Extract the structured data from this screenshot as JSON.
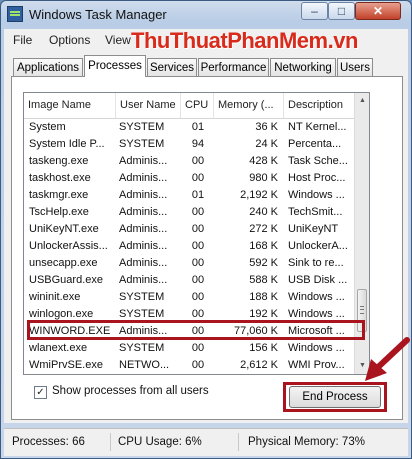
{
  "window": {
    "title": "Windows Task Manager",
    "min_glyph": "–",
    "max_glyph": "□",
    "close_glyph": "✕"
  },
  "menu": [
    "File",
    "Options",
    "View"
  ],
  "watermark": "ThuThuatPhanMem.vn",
  "tabs": [
    {
      "label": "Applications",
      "active": false
    },
    {
      "label": "Processes",
      "active": true
    },
    {
      "label": "Services",
      "active": false
    },
    {
      "label": "Performance",
      "active": false
    },
    {
      "label": "Networking",
      "active": false
    },
    {
      "label": "Users",
      "active": false
    }
  ],
  "columns": [
    "Image Name",
    "User Name",
    "CPU",
    "Memory (...",
    "Description"
  ],
  "rows": [
    [
      "System",
      "SYSTEM",
      "01",
      "36 K",
      "NT Kernel..."
    ],
    [
      "System Idle P...",
      "SYSTEM",
      "94",
      "24 K",
      "Percenta..."
    ],
    [
      "taskeng.exe",
      "Adminis...",
      "00",
      "428 K",
      "Task Sche..."
    ],
    [
      "taskhost.exe",
      "Adminis...",
      "00",
      "980 K",
      "Host Proc..."
    ],
    [
      "taskmgr.exe",
      "Adminis...",
      "01",
      "2,192 K",
      "Windows ..."
    ],
    [
      "TscHelp.exe",
      "Adminis...",
      "00",
      "240 K",
      "TechSmit..."
    ],
    [
      "UniKeyNT.exe",
      "Adminis...",
      "00",
      "272 K",
      "UniKeyNT"
    ],
    [
      "UnlockerAssis...",
      "Adminis...",
      "00",
      "168 K",
      "UnlockerA..."
    ],
    [
      "unsecapp.exe",
      "Adminis...",
      "00",
      "592 K",
      "Sink to re..."
    ],
    [
      "USBGuard.exe",
      "Adminis...",
      "00",
      "588 K",
      "USB Disk ..."
    ],
    [
      "wininit.exe",
      "SYSTEM",
      "00",
      "188 K",
      "Windows ..."
    ],
    [
      "winlogon.exe",
      "SYSTEM",
      "00",
      "192 K",
      "Windows ..."
    ],
    [
      "WINWORD.EXE",
      "Adminis...",
      "00",
      "77,060 K",
      "Microsoft ..."
    ],
    [
      "wlanext.exe",
      "SYSTEM",
      "00",
      "156 K",
      "Windows ..."
    ],
    [
      "WmiPrvSE.exe",
      "NETWO...",
      "00",
      "2,612 K",
      "WMI Prov..."
    ]
  ],
  "highlighted_row": "WINWORD.EXE",
  "show_all_label": "Show processes from all users",
  "show_all_checked": "✓",
  "end_process_label": "End Process",
  "status": {
    "processes": "Processes: 66",
    "cpu": "CPU Usage: 6%",
    "memory": "Physical Memory: 73%"
  },
  "scroll_up_glyph": "▲",
  "scroll_down_glyph": "▼",
  "colors": {
    "annotation": "#a9141e",
    "watermark": "#d92b1b"
  },
  "icons": [
    "task-manager-app-icon",
    "minimize-icon",
    "maximize-icon",
    "close-icon",
    "annotation-arrow-icon",
    "scroll-up-icon",
    "scroll-down-icon"
  ]
}
